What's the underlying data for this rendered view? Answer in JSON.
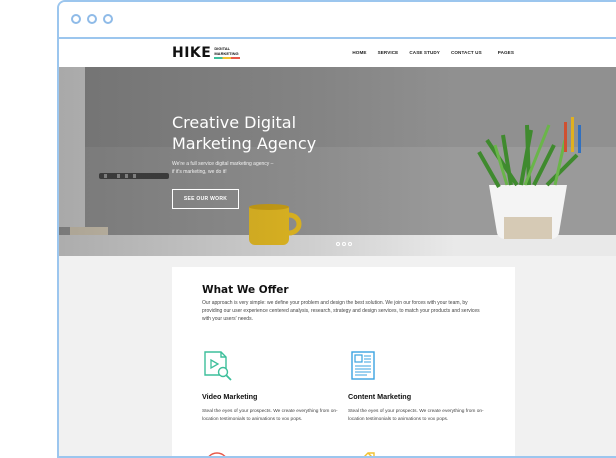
{
  "window": {
    "traffic_dots": 3
  },
  "site": {
    "logo": {
      "word": "HIKE",
      "subtitle_line1": "DIGITAL",
      "subtitle_line2": "MARKETING"
    },
    "nav": [
      "HOME",
      "SERVICE",
      "CASE STUDY",
      "CONTACT US",
      "PAGES"
    ]
  },
  "hero": {
    "title_line1": "Creative Digital",
    "title_line2": "Marketing Agency",
    "subtitle_line1": "We're a full service digital marketing agency –",
    "subtitle_line2": "if it's marketing, we do it!",
    "button_label": "SEE OUR WORK",
    "slides": 3,
    "active_slide": 1
  },
  "offer": {
    "heading": "What We Offer",
    "intro": "Our approach is very simple: we define your problem and design the best solution. We join our forces with your team, by providing our user experience centered analysis, research, strategy and design services, to match your products and services with your users' needs.",
    "services": [
      {
        "icon": "video-search-icon",
        "title": "Video Marketing",
        "text": "Steal the eyes of your prospects. We create everything from on-location testimonials to animations to vox pops."
      },
      {
        "icon": "newspaper-icon",
        "title": "Content Marketing",
        "text": "Steal the eyes of your prospects. We create everything from on-location testimonials to animations to vox pops."
      }
    ],
    "next_icons": [
      "target-icon",
      "rocket-icon"
    ]
  },
  "colors": {
    "frame": "#9cc6ee",
    "accent_green": "#3dbf9b",
    "accent_blue": "#3aa3e0",
    "accent_red": "#e8594a",
    "accent_yellow": "#f2c230"
  }
}
